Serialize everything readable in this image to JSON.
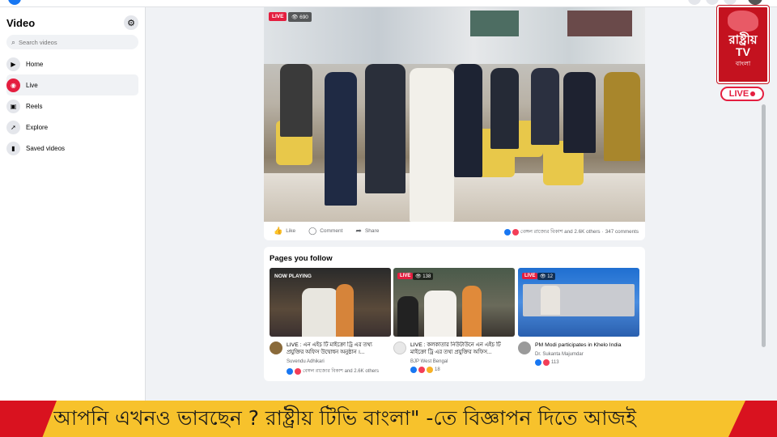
{
  "sidebar": {
    "title": "Video",
    "search_placeholder": "Search videos",
    "items": [
      {
        "label": "Home",
        "icon": "play-icon"
      },
      {
        "label": "Live",
        "icon": "live-camera-icon"
      },
      {
        "label": "Reels",
        "icon": "reels-icon"
      },
      {
        "label": "Explore",
        "icon": "explore-icon"
      },
      {
        "label": "Saved videos",
        "icon": "bookmark-icon"
      }
    ]
  },
  "post": {
    "live_label": "LIVE",
    "viewers": "690",
    "actions": {
      "like": "Like",
      "comment": "Comment",
      "share": "Share"
    },
    "reactions_text": "বেঙ্গল রাজ্যের বিকাশ and 2.6K others",
    "comments": "347 comments"
  },
  "pages": {
    "title": "Pages you follow",
    "cards": [
      {
        "badge": "NOW PLAYING",
        "title": "LIVE : এন এইচ টি মাইক্রো ট্রি এর তথ্য প্রযুক্তির অফিস উদ্বোধন অনুষ্ঠান ।...",
        "author": "Suvendu Adhikari",
        "reactions": "বেঙ্গল রাজ্যের বিকাশ and 2.6K others"
      },
      {
        "badge": "LIVE",
        "viewers": "138",
        "title": "LIVE : কলকাতার নিউটাউনে এন এইচ টি মাইক্রো ট্রি এর তথ্য প্রযুক্তির অফিস...",
        "author": "BJP West Bengal",
        "reactions": "18"
      },
      {
        "badge": "LIVE",
        "viewers": "12",
        "title": "PM Modi participates in Khelo India",
        "author": "Dr. Sukanta Majumdar",
        "reactions": "113"
      }
    ]
  },
  "logo": {
    "name": "রাষ্ট্রীয়",
    "tv": "TV",
    "sub": "বাংলা",
    "live": "LIVE"
  },
  "ticker": {
    "text": "আপনি এখনও ভাবছেন ? রাষ্ট্রীয় টিভি বাংলা\" -তে বিজ্ঞাপন দিতে আজই"
  },
  "colors": {
    "accent": "#1877f2",
    "live": "#e41e3f",
    "ticker_bg": "#f7c22c",
    "ticker_red": "#d9121f"
  }
}
